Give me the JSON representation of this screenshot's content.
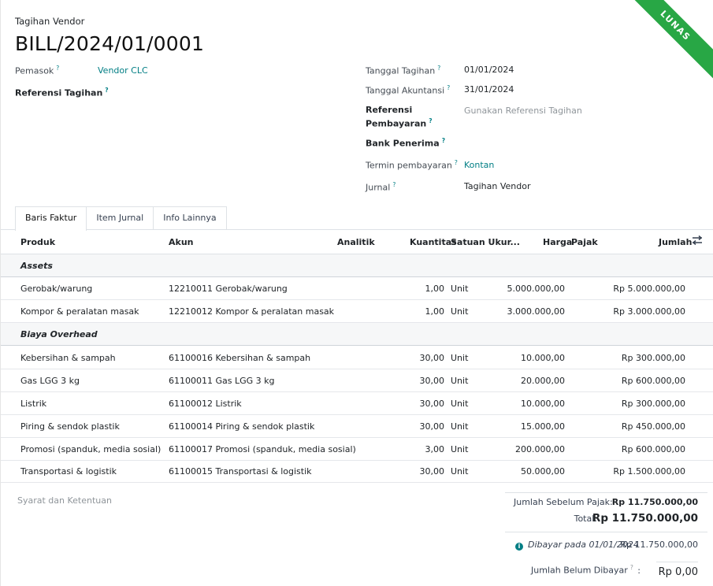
{
  "header": {
    "breadcrumb": "Tagihan Vendor",
    "title": "BILL/2024/01/0001",
    "status_ribbon": "LUNAS",
    "status_color": "#28a745"
  },
  "form": {
    "left": {
      "vendor_label": "Pemasok",
      "vendor_value": "Vendor CLC",
      "bill_ref_label": "Referensi Tagihan"
    },
    "right": {
      "bill_date_label": "Tanggal Tagihan",
      "bill_date_value": "01/01/2024",
      "accounting_date_label": "Tanggal Akuntansi",
      "accounting_date_value": "31/01/2024",
      "payment_ref_label_1": "Referensi",
      "payment_ref_label_2": "Pembayaran",
      "payment_ref_placeholder": "Gunakan Referensi Tagihan",
      "bank_label": "Bank Penerima",
      "terms_label": "Termin pembayaran",
      "terms_value": "Kontan",
      "journal_label": "Jurnal",
      "journal_value": "Tagihan Vendor"
    },
    "help_mark": "?"
  },
  "tabs": [
    {
      "label": "Baris Faktur",
      "active": true
    },
    {
      "label": "Item Jurnal",
      "active": false
    },
    {
      "label": "Info Lainnya",
      "active": false
    }
  ],
  "table": {
    "columns": {
      "product": "Produk",
      "account": "Akun",
      "analytic": "Analitik",
      "quantity": "Kuantitas",
      "uom": "Satuan Ukur...",
      "price": "Harga",
      "tax": "Pajak",
      "amount": "Jumlah"
    },
    "rows": [
      {
        "type": "section",
        "label": "Assets"
      },
      {
        "type": "line",
        "product": "Gerobak/warung",
        "account": "12210011 Gerobak/warung",
        "quantity": "1,00",
        "uom": "Unit",
        "price": "5.000.000,00",
        "amount": "Rp 5.000.000,00"
      },
      {
        "type": "line",
        "product": "Kompor & peralatan masak",
        "account": "12210012 Kompor & peralatan masak",
        "quantity": "1,00",
        "uom": "Unit",
        "price": "3.000.000,00",
        "amount": "Rp 3.000.000,00"
      },
      {
        "type": "section",
        "label": "Biaya Overhead"
      },
      {
        "type": "line",
        "product": "Kebersihan & sampah",
        "account": "61100016 Kebersihan & sampah",
        "quantity": "30,00",
        "uom": "Unit",
        "price": "10.000,00",
        "amount": "Rp 300.000,00"
      },
      {
        "type": "line",
        "product": "Gas LGG 3 kg",
        "account": "61100011 Gas LGG 3 kg",
        "quantity": "30,00",
        "uom": "Unit",
        "price": "20.000,00",
        "amount": "Rp 600.000,00"
      },
      {
        "type": "line",
        "product": "Listrik",
        "account": "61100012 Listrik",
        "quantity": "30,00",
        "uom": "Unit",
        "price": "10.000,00",
        "amount": "Rp 300.000,00"
      },
      {
        "type": "line",
        "product": "Piring & sendok plastik",
        "account": "61100014 Piring & sendok plastik",
        "quantity": "30,00",
        "uom": "Unit",
        "price": "15.000,00",
        "amount": "Rp 450.000,00"
      },
      {
        "type": "line",
        "product": "Promosi (spanduk, media sosial)",
        "account": "61100017 Promosi (spanduk, media sosial)",
        "quantity": "3,00",
        "uom": "Unit",
        "price": "200.000,00",
        "amount": "Rp 600.000,00"
      },
      {
        "type": "line",
        "product": "Transportasi & logistik",
        "account": "61100015 Transportasi & logistik",
        "quantity": "30,00",
        "uom": "Unit",
        "price": "50.000,00",
        "amount": "Rp 1.500.000,00"
      }
    ]
  },
  "footer": {
    "terms_placeholder": "Syarat dan Ketentuan",
    "untaxed_label": "Jumlah Sebelum Pajak:",
    "untaxed_value": "Rp 11.750.000,00",
    "total_label": "Total:",
    "total_value": "Rp 11.750.000,00",
    "paid_label": "Dibayar pada 01/01/2024",
    "paid_value": "Rp 11.750.000,00",
    "residual_label": "Jumlah Belum Dibayar",
    "residual_value": "Rp 0,00"
  },
  "colors": {
    "link": "#017e84",
    "ribbon": "#28a745"
  }
}
